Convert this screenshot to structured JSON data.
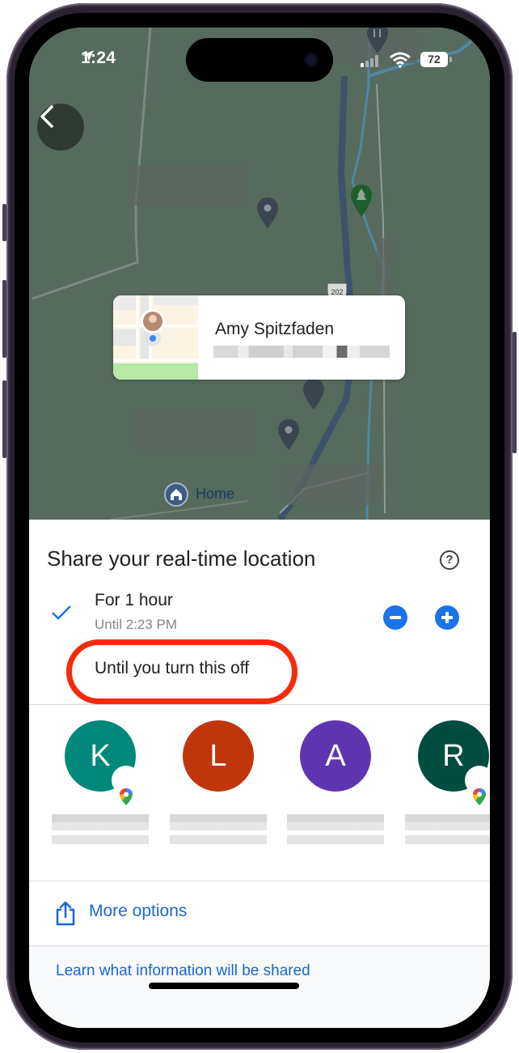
{
  "status_bar": {
    "time": "1:24",
    "location_icon": "location-arrow-icon",
    "signal_icon": "cellular-signal-icon",
    "wifi_icon": "wifi-icon",
    "battery_level": "72"
  },
  "map": {
    "back_icon": "chevron-left-icon",
    "home_label": "Home",
    "route_shield": "202",
    "person_card": {
      "name": "Amy Spitzfaden",
      "subtitle_blurred": true
    }
  },
  "sheet": {
    "title": "Share your real-time location",
    "help_icon": "help-circle-icon",
    "options": [
      {
        "label": "For 1 hour",
        "sublabel": "Until 2:23 PM",
        "selected": true
      },
      {
        "label": "Until you turn this off",
        "selected": false
      }
    ],
    "decrease_icon": "minus-circle-icon",
    "increase_icon": "plus-circle-icon",
    "annotation_color": "#f62a0a",
    "contacts": [
      {
        "initial": "K",
        "color": "#00897b",
        "maps_badge": true
      },
      {
        "initial": "L",
        "color": "#bf360c",
        "maps_badge": false
      },
      {
        "initial": "A",
        "color": "#5e35b1",
        "maps_badge": false
      },
      {
        "initial": "R",
        "color": "#004d40",
        "maps_badge": true
      }
    ],
    "more_options_label": "More options",
    "share_icon": "share-icon",
    "learn_link": "Learn what information will be shared"
  },
  "colors": {
    "accent": "#1a73e8",
    "link": "#1967d2",
    "map_bg": "#566a5d"
  }
}
